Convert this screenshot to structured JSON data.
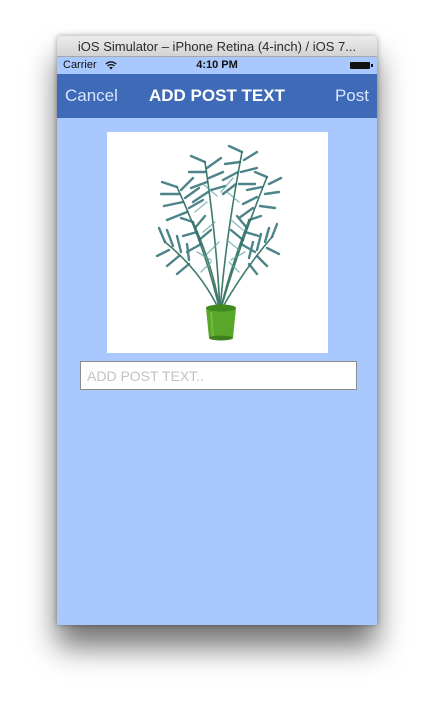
{
  "window": {
    "title": "iOS Simulator – iPhone Retina (4-inch) / iOS 7..."
  },
  "statusbar": {
    "carrier": "Carrier",
    "time": "4:10 PM",
    "wifi_icon": "wifi-icon",
    "battery_icon": "battery-icon"
  },
  "navbar": {
    "cancel_label": "Cancel",
    "title": "ADD POST TEXT",
    "post_label": "Post"
  },
  "post": {
    "image_alt": "potted palm plant",
    "text_value": "",
    "placeholder": "ADD POST TEXT.."
  },
  "colors": {
    "background": "#a9c8fd",
    "navbar": "#3f6ab8",
    "nav_text": "#ffffff",
    "nav_button_text": "#d7e6ff"
  }
}
